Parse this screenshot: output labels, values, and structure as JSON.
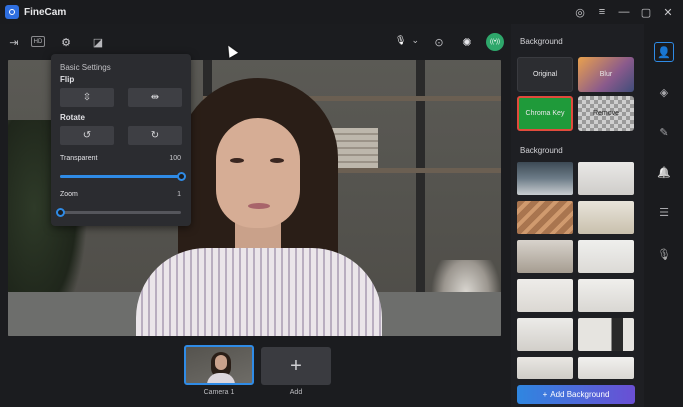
{
  "app": {
    "title": "FineCam"
  },
  "window_controls": {
    "account": "◎",
    "menu": "≡",
    "minimize": "—",
    "maximize": "▢",
    "close": "✕"
  },
  "toolbar": {
    "exit_glyph": "⇥",
    "hd_glyph": "HD",
    "settings_glyph": "⚙",
    "sticker_glyph": "◪",
    "mic_glyph": "🎙",
    "mic_caret": "⌄",
    "camera_glyph": "⊙",
    "effects_glyph": "✺",
    "record_glyph": "((•))"
  },
  "basic_settings": {
    "title": "Basic Settings",
    "flip_label": "Flip",
    "flip_vertical_glyph": "⇳",
    "flip_horizontal_glyph": "⇹",
    "rotate_label": "Rotate",
    "rotate_left_glyph": "↺",
    "rotate_right_glyph": "↻",
    "transparent_label": "Transparent",
    "transparent_value": "100",
    "transparent_fraction": 1.0,
    "zoom_label": "Zoom",
    "zoom_value": "1",
    "zoom_fraction": 0.0
  },
  "cameras": {
    "items": [
      {
        "label": "Camera 1"
      }
    ],
    "add_label": "Add",
    "add_glyph": "+"
  },
  "background_panel": {
    "heading_top": "Background",
    "modes": [
      {
        "label": "Original"
      },
      {
        "label": "Blur"
      },
      {
        "label": "Chroma Key"
      },
      {
        "label": "Remove"
      }
    ],
    "heading_bottom": "Background",
    "add_button": {
      "glyph": "+",
      "label": "Add Background"
    }
  },
  "side_rail": {
    "person": "👤",
    "layers": "◈",
    "magic": "✎",
    "alert": "🔔",
    "adjust": "☰",
    "mic": "🎙"
  }
}
